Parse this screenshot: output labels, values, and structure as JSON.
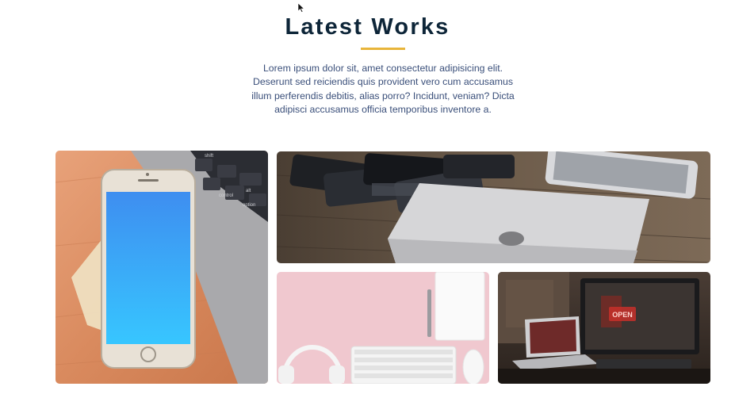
{
  "section": {
    "title": "Latest Works",
    "description": "Lorem ipsum dolor sit, amet consectetur adipisicing elit. Deserunt sed reiciendis quis provident vero cum accusamus illum perferendis debitis, alias porro? Incidunt, veniam? Dicta adipisci accusamus officia temporibus inventore a.",
    "accent_color": "#e8b53a",
    "title_color": "#0d2538",
    "text_color": "#3a4f7a"
  },
  "portfolio": {
    "items": [
      {
        "subject": "iphone-on-laptop-photo",
        "key_labels": [
          "shift",
          "control",
          "option",
          "alt"
        ]
      },
      {
        "subject": "laptop-and-phones-photo"
      },
      {
        "subject": "headphones-keyboard-photo"
      },
      {
        "subject": "workspace-computer-photo",
        "sign_text": "OPEN"
      }
    ]
  }
}
